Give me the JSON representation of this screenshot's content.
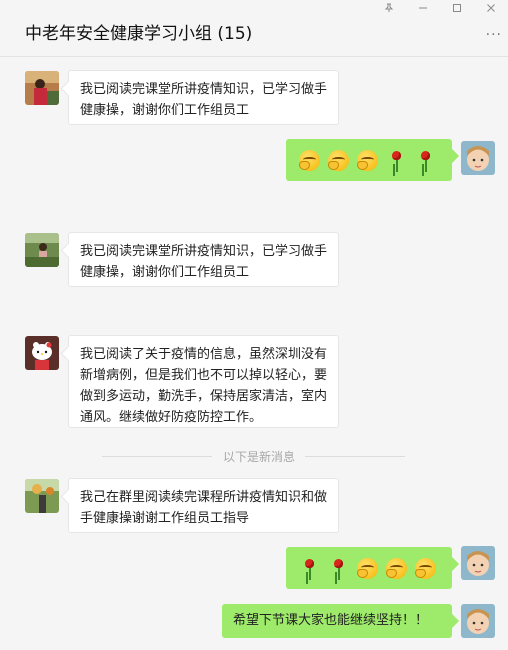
{
  "window": {
    "title": "中老年安全健康学习小组 (15)",
    "controls": [
      "pin-icon",
      "minimize-icon",
      "maximize-icon",
      "close-icon"
    ],
    "more_label": "···"
  },
  "messages": [
    {
      "side": "left",
      "avatar": "avatar-person-1",
      "text": "我已阅读完课堂所讲疫情知识，已学习做手健康操，谢谢你们工作组员工"
    },
    {
      "side": "right",
      "avatar": "avatar-self",
      "emojis": [
        "smirk-emoji",
        "smirk-emoji",
        "smirk-emoji",
        "rose-emoji",
        "rose-emoji"
      ]
    },
    {
      "side": "left",
      "avatar": "avatar-person-2",
      "text": "我已阅读完课堂所讲疫情知识，已学习做手健康操，谢谢你们工作组员工"
    },
    {
      "side": "left",
      "avatar": "avatar-hello-kitty",
      "text": "我已阅读了关于疫情的信息，虽然深圳没有新增病例，但是我们也不可以掉以轻心，要做到多运动，勤洗手，保持居家清洁，室内通风。继续做好防疫防控工作。"
    },
    {
      "side": "left",
      "avatar": "avatar-person-3",
      "text": "我己在群里阅读续完课程所讲疫情知识和做手健康操谢谢工作组员工指导"
    },
    {
      "side": "right",
      "avatar": "avatar-self",
      "emojis": [
        "rose-emoji",
        "rose-emoji",
        "smirk-emoji",
        "smirk-emoji",
        "smirk-emoji"
      ]
    },
    {
      "side": "right",
      "avatar": "avatar-self",
      "text": "希望下节课大家也能继续坚持！！"
    }
  ],
  "divider": {
    "text": "以下是新消息"
  },
  "colors": {
    "self_bubble": "#9eea6a",
    "other_bubble": "#ffffff",
    "background": "#f5f5f5"
  }
}
